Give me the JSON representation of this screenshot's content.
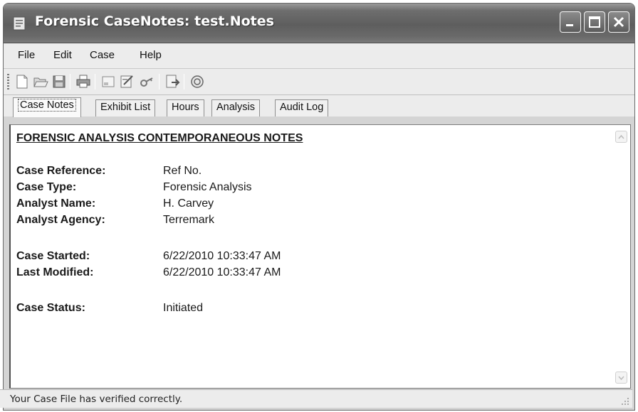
{
  "window": {
    "title": "Forensic CaseNotes: test.Notes"
  },
  "menu": [
    {
      "label": "File"
    },
    {
      "label": "Edit"
    },
    {
      "label": "Case"
    },
    {
      "label": "Help"
    }
  ],
  "toolbar": {
    "icons": [
      "new-icon",
      "open-icon",
      "save-icon",
      "print-icon",
      "form-icon",
      "edit-icon",
      "key-icon",
      "export-icon",
      "help-icon"
    ]
  },
  "tabs": [
    {
      "label": "Case Notes",
      "active": true
    },
    {
      "label": "Exhibit List",
      "active": false
    },
    {
      "label": "Hours",
      "active": false
    },
    {
      "label": "Analysis",
      "active": false
    },
    {
      "label": "Audit Log",
      "active": false
    }
  ],
  "notes": {
    "heading": "FORENSIC ANALYSIS CONTEMPORANEOUS NOTES",
    "fields": [
      {
        "label": "Case Reference:",
        "value": "Ref No."
      },
      {
        "label": "Case Type:",
        "value": "Forensic Analysis"
      },
      {
        "label": "Analyst Name:",
        "value": "H. Carvey"
      },
      {
        "label": "Analyst Agency:",
        "value": "Terremark"
      },
      {
        "label": "Case Started:",
        "value": "6/22/2010 10:33:47 AM"
      },
      {
        "label": "Last Modified:",
        "value": "6/22/2010 10:33:47 AM"
      },
      {
        "label": "Case Status:",
        "value": "Initiated"
      }
    ]
  },
  "status": {
    "message": "Your Case File has verified correctly."
  }
}
